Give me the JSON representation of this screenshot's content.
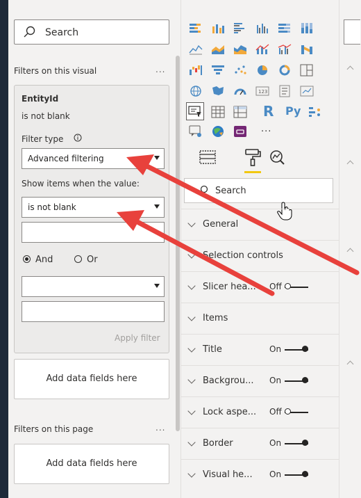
{
  "filters": {
    "search_label": "Search",
    "visual_header": "Filters on this visual",
    "visual_more": "...",
    "card": {
      "field": "EntityId",
      "summary": "is not blank",
      "filter_type_label": "Filter type",
      "filter_type_value": "Advanced filtering",
      "show_items_label": "Show items when the value:",
      "condition1_value": "is not blank",
      "and_label": "And",
      "or_label": "Or",
      "apply_label": "Apply filter"
    },
    "add_fields_visual": "Add data fields here",
    "page_header": "Filters on this page",
    "page_more": "...",
    "add_fields_page": "Add data fields here"
  },
  "viz": {
    "more_label": "...",
    "r_label": "R",
    "py_label": "Py",
    "search_label": "Search",
    "format_rows": [
      {
        "name": "General",
        "state": "",
        "toggle": ""
      },
      {
        "name": "Selection controls",
        "state": "",
        "toggle": ""
      },
      {
        "name": "Slicer hea...",
        "state": "Off",
        "toggle": "off"
      },
      {
        "name": "Items",
        "state": "",
        "toggle": ""
      },
      {
        "name": "Title",
        "state": "On",
        "toggle": "on"
      },
      {
        "name": "Backgrou...",
        "state": "On",
        "toggle": "on"
      },
      {
        "name": "Lock aspe...",
        "state": "Off",
        "toggle": "off"
      },
      {
        "name": "Border",
        "state": "On",
        "toggle": "on"
      },
      {
        "name": "Visual he...",
        "state": "On",
        "toggle": "on"
      }
    ]
  },
  "colors": {
    "arrow": "#e8413c",
    "accent": "#f2c811"
  }
}
